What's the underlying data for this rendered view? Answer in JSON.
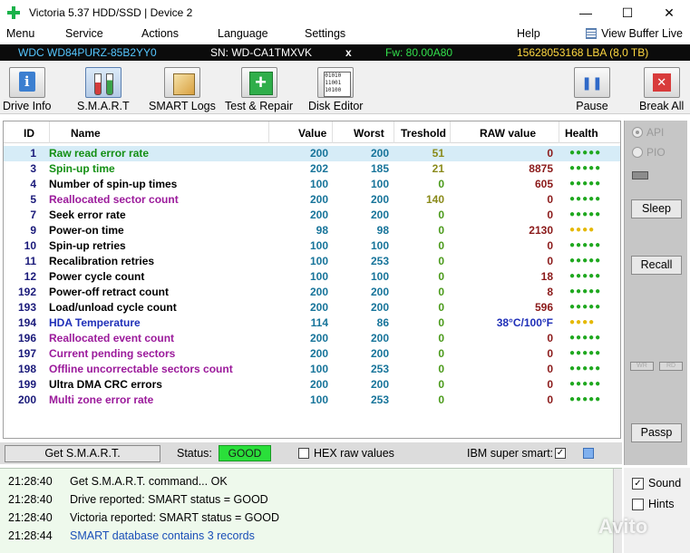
{
  "window": {
    "title": "Victoria 5.37 HDD/SSD | Device 2",
    "minimize": "—",
    "maximize": "☐",
    "close": "✕"
  },
  "menu": {
    "items": [
      "Menu",
      "Service",
      "Actions",
      "Language",
      "Settings",
      "Help"
    ],
    "view_buffer": "View Buffer Live"
  },
  "drive": {
    "model": "WDC WD84PURZ-85B2YY0",
    "sn": "SN: WD-CA1TMXVK",
    "x": "x",
    "fw": "Fw: 80.00A80",
    "lba": "15628053168 LBA (8,0 TB)"
  },
  "toolbar": {
    "drive_info": "Drive Info",
    "smart": "S.M.A.R.T",
    "smart_logs": "SMART Logs",
    "test_repair": "Test & Repair",
    "disk_editor": "Disk Editor",
    "pause": "Pause",
    "break_all": "Break All"
  },
  "table": {
    "headers": {
      "id": "ID",
      "name": "Name",
      "value": "Value",
      "worst": "Worst",
      "treshold": "Treshold",
      "raw": "RAW value",
      "health": "Health"
    },
    "rows": [
      {
        "id": "1",
        "name": "Raw read error rate",
        "value": "200",
        "worst": "200",
        "tresh": "51",
        "raw": "0",
        "health": "●●●●●"
      },
      {
        "id": "3",
        "name": "Spin-up time",
        "value": "202",
        "worst": "185",
        "tresh": "21",
        "raw": "8875",
        "health": "●●●●●"
      },
      {
        "id": "4",
        "name": "Number of spin-up times",
        "value": "100",
        "worst": "100",
        "tresh": "0",
        "raw": "605",
        "health": "●●●●●"
      },
      {
        "id": "5",
        "name": "Reallocated sector count",
        "value": "200",
        "worst": "200",
        "tresh": "140",
        "raw": "0",
        "health": "●●●●●"
      },
      {
        "id": "7",
        "name": "Seek error rate",
        "value": "200",
        "worst": "200",
        "tresh": "0",
        "raw": "0",
        "health": "●●●●●"
      },
      {
        "id": "9",
        "name": "Power-on time",
        "value": "98",
        "worst": "98",
        "tresh": "0",
        "raw": "2130",
        "health": "●●●●"
      },
      {
        "id": "10",
        "name": "Spin-up retries",
        "value": "100",
        "worst": "100",
        "tresh": "0",
        "raw": "0",
        "health": "●●●●●"
      },
      {
        "id": "11",
        "name": "Recalibration retries",
        "value": "100",
        "worst": "253",
        "tresh": "0",
        "raw": "0",
        "health": "●●●●●"
      },
      {
        "id": "12",
        "name": "Power cycle count",
        "value": "100",
        "worst": "100",
        "tresh": "0",
        "raw": "18",
        "health": "●●●●●"
      },
      {
        "id": "192",
        "name": "Power-off retract count",
        "value": "200",
        "worst": "200",
        "tresh": "0",
        "raw": "8",
        "health": "●●●●●"
      },
      {
        "id": "193",
        "name": "Load/unload cycle count",
        "value": "200",
        "worst": "200",
        "tresh": "0",
        "raw": "596",
        "health": "●●●●●"
      },
      {
        "id": "194",
        "name": "HDA Temperature",
        "value": "114",
        "worst": "86",
        "tresh": "0",
        "raw": "38°C/100°F",
        "health": "●●●●"
      },
      {
        "id": "196",
        "name": "Reallocated event count",
        "value": "200",
        "worst": "200",
        "tresh": "0",
        "raw": "0",
        "health": "●●●●●"
      },
      {
        "id": "197",
        "name": "Current pending sectors",
        "value": "200",
        "worst": "200",
        "tresh": "0",
        "raw": "0",
        "health": "●●●●●"
      },
      {
        "id": "198",
        "name": "Offline uncorrectable sectors count",
        "value": "100",
        "worst": "253",
        "tresh": "0",
        "raw": "0",
        "health": "●●●●●"
      },
      {
        "id": "199",
        "name": "Ultra DMA CRC errors",
        "value": "200",
        "worst": "200",
        "tresh": "0",
        "raw": "0",
        "health": "●●●●●"
      },
      {
        "id": "200",
        "name": "Multi zone error rate",
        "value": "100",
        "worst": "253",
        "tresh": "0",
        "raw": "0",
        "health": "●●●●●"
      }
    ]
  },
  "right_panel": {
    "api": "API",
    "pio": "PIO",
    "sleep": "Sleep",
    "recall": "Recall",
    "wr": "WR",
    "rd": "RD",
    "passp": "Passp"
  },
  "status_strip": {
    "get_smart": "Get S.M.A.R.T.",
    "status_label": "Status:",
    "status_value": "GOOD",
    "hex_raw": "HEX raw values",
    "ibm_super_smart": "IBM super smart:",
    "check": "✓"
  },
  "log": [
    {
      "time": "21:28:40",
      "msg": "Get S.M.A.R.T. command... OK",
      "color": "#000000"
    },
    {
      "time": "21:28:40",
      "msg": "Drive reported: SMART status = GOOD",
      "color": "#000000"
    },
    {
      "time": "21:28:40",
      "msg": "Victoria reported: SMART status = GOOD",
      "color": "#000000"
    },
    {
      "time": "21:28:44",
      "msg": "SMART database contains 3 records",
      "color": "#1a4fb8"
    }
  ],
  "sound_hints": {
    "sound": "Sound",
    "hints": "Hints",
    "check": "✓"
  },
  "watermark": "Avito",
  "colors": {
    "name_colors": {
      "1": "#138f13",
      "3": "#138f13",
      "4": "#000000",
      "5": "#9b1a9b",
      "7": "#000000",
      "9": "#000000",
      "10": "#000000",
      "11": "#000000",
      "12": "#000000",
      "192": "#000000",
      "193": "#000000",
      "194": "#1f2fb8",
      "196": "#9b1a9b",
      "197": "#9b1a9b",
      "198": "#9b1a9b",
      "199": "#000000",
      "200": "#9b1a9b"
    },
    "value_color": "#17749a",
    "worst_color": "#17749a",
    "tresh_color_default": "#4a9a1a",
    "tresh_color_nonzero": "#8a8a1a",
    "raw_color": "#8b1a1a",
    "health_green": "#1fa81f",
    "health_yellow": "#e5b800",
    "status_good": "#2adf3a"
  }
}
